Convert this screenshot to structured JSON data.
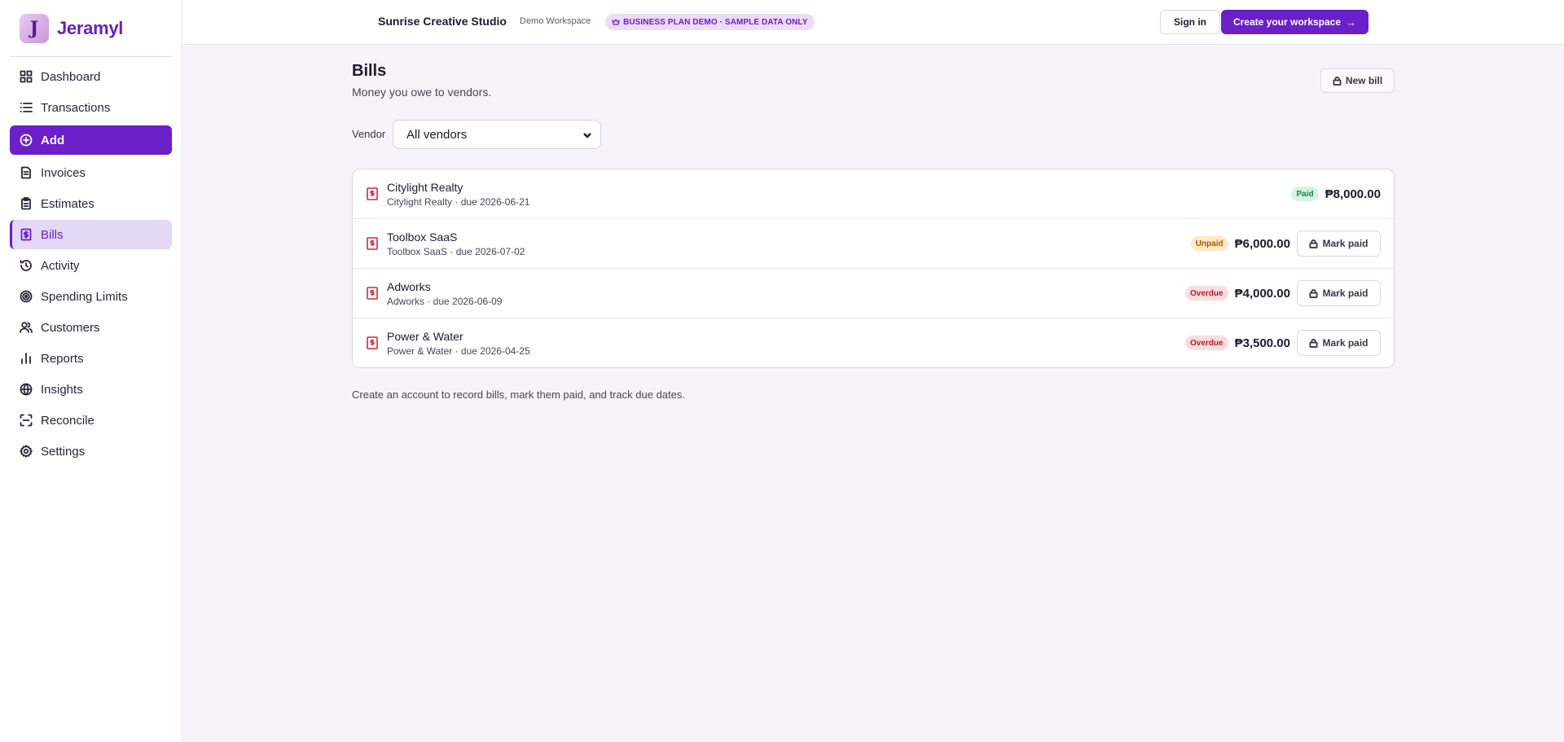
{
  "brand": {
    "name": "Jeramyl",
    "logo_letter": "J"
  },
  "sidebar": {
    "items": [
      {
        "label": "Dashboard",
        "icon": "dashboard-icon"
      },
      {
        "label": "Transactions",
        "icon": "list-icon"
      },
      {
        "label": "Add",
        "icon": "plus-circle-icon"
      },
      {
        "label": "Invoices",
        "icon": "invoice-icon"
      },
      {
        "label": "Estimates",
        "icon": "clipboard-icon"
      },
      {
        "label": "Bills",
        "icon": "bill-icon"
      },
      {
        "label": "Activity",
        "icon": "history-icon"
      },
      {
        "label": "Spending Limits",
        "icon": "target-icon"
      },
      {
        "label": "Customers",
        "icon": "users-icon"
      },
      {
        "label": "Reports",
        "icon": "bar-chart-icon"
      },
      {
        "label": "Insights",
        "icon": "globe-icon"
      },
      {
        "label": "Reconcile",
        "icon": "scan-icon"
      },
      {
        "label": "Settings",
        "icon": "gear-icon"
      }
    ]
  },
  "header": {
    "workspace_name": "Sunrise Creative Studio",
    "workspace_sub": "Demo Workspace",
    "demo_badge": "BUSINESS PLAN DEMO · SAMPLE DATA ONLY",
    "signin_label": "Sign in",
    "create_label": "Create your workspace"
  },
  "main": {
    "title": "Bills",
    "subtitle": "Money you owe to vendors.",
    "new_bill_label": "New bill",
    "vendor_label": "Vendor",
    "vendor_selected": "All vendors",
    "bills": [
      {
        "name": "Citylight Realty",
        "meta": "Citylight Realty · due 2026-06-21",
        "status": "Paid",
        "amount": "₱8,000.00",
        "action": ""
      },
      {
        "name": "Toolbox SaaS",
        "meta": "Toolbox SaaS · due 2026-07-02",
        "status": "Unpaid",
        "amount": "₱6,000.00",
        "action": "Mark paid"
      },
      {
        "name": "Adworks",
        "meta": "Adworks · due 2026-06-09",
        "status": "Overdue",
        "amount": "₱4,000.00",
        "action": "Mark paid"
      },
      {
        "name": "Power & Water",
        "meta": "Power & Water · due 2026-04-25",
        "status": "Overdue",
        "amount": "₱3,500.00",
        "action": "Mark paid"
      }
    ],
    "footer_note": "Create an account to record bills, mark them paid, and track due dates."
  },
  "colors": {
    "accent": "#6b1fc8",
    "background": "#f7f3fb",
    "paid": "#19824a",
    "unpaid": "#a35d00",
    "overdue": "#c0162b",
    "bill_icon": "#d1293d"
  }
}
